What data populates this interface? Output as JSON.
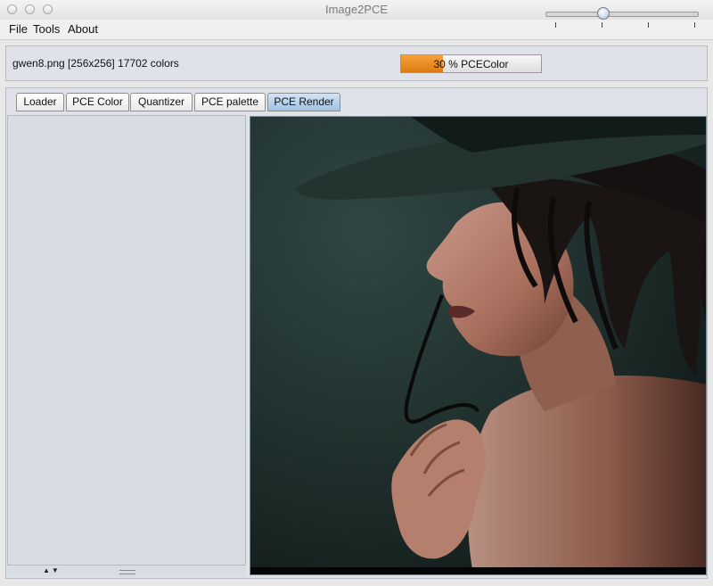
{
  "window": {
    "title": "Image2PCE"
  },
  "menu": {
    "items": [
      "File",
      "Tools",
      "About"
    ]
  },
  "info": {
    "file_info": "gwen8.png [256x256] 17702 colors"
  },
  "progress": {
    "label": "30 % PCEColor",
    "value_percent": 30
  },
  "slider": {
    "position_fraction": 0.38,
    "tick_count": 4
  },
  "tabs": {
    "items": [
      "Loader",
      "PCE Color",
      "Quantizer",
      "PCE palette",
      "PCE Render"
    ],
    "active": "PCE Render"
  },
  "colors": {
    "progress_fill": "#e88a1e",
    "active_tab": "#b6d1ec",
    "panel": "#dfe2e8"
  }
}
